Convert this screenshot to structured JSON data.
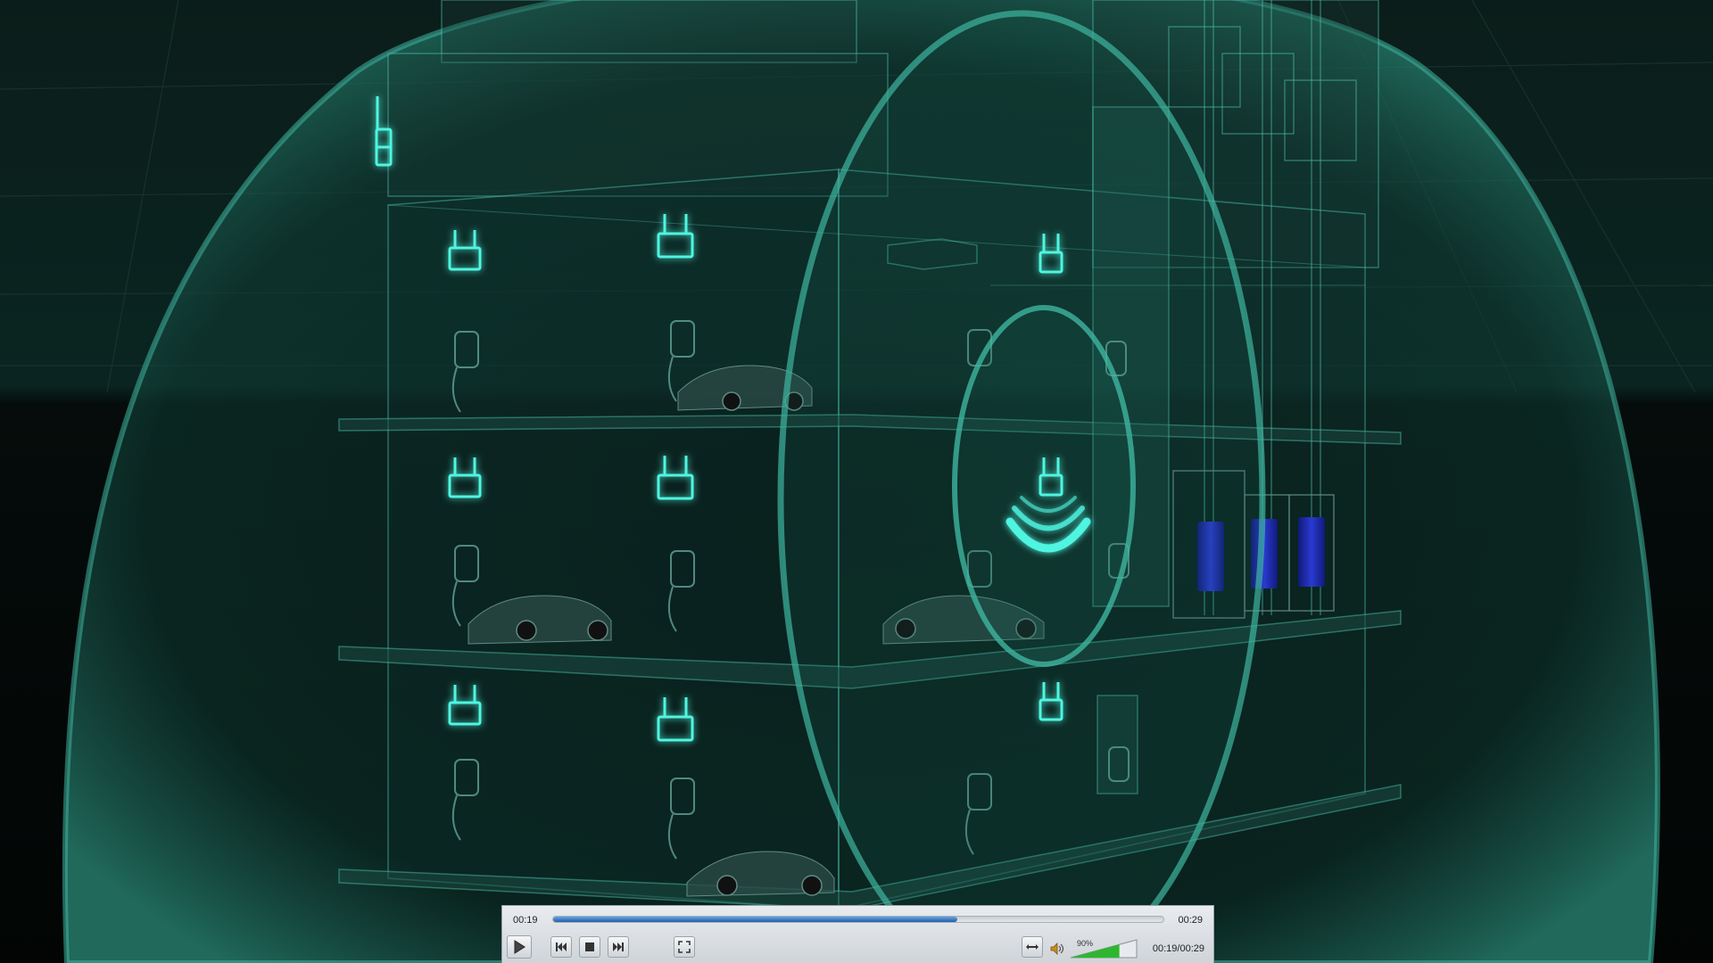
{
  "video": {
    "description_colors": {
      "background": "#030807",
      "glow": "#4ff5e0",
      "wire": "#4fc9b5",
      "dome": "#1e6b5d",
      "battery": "#1a2a9e"
    },
    "center_signal_icon": "wifi-signal-icon"
  },
  "player": {
    "time_elapsed": "00:19",
    "time_total": "00:29",
    "time_combined": "00:19/00:29",
    "progress_fraction": 0.663,
    "volume_percent": "90%",
    "volume_fraction": 0.9,
    "icons": {
      "play": "play-icon",
      "prev": "skip-back-icon",
      "stop": "stop-icon",
      "next": "skip-forward-icon",
      "fullscreen": "fullscreen-icon",
      "aspect": "aspect-ratio-icon",
      "volume": "speaker-icon"
    },
    "accent_color": "#1f5fae",
    "volume_color": "#2fb62f"
  }
}
